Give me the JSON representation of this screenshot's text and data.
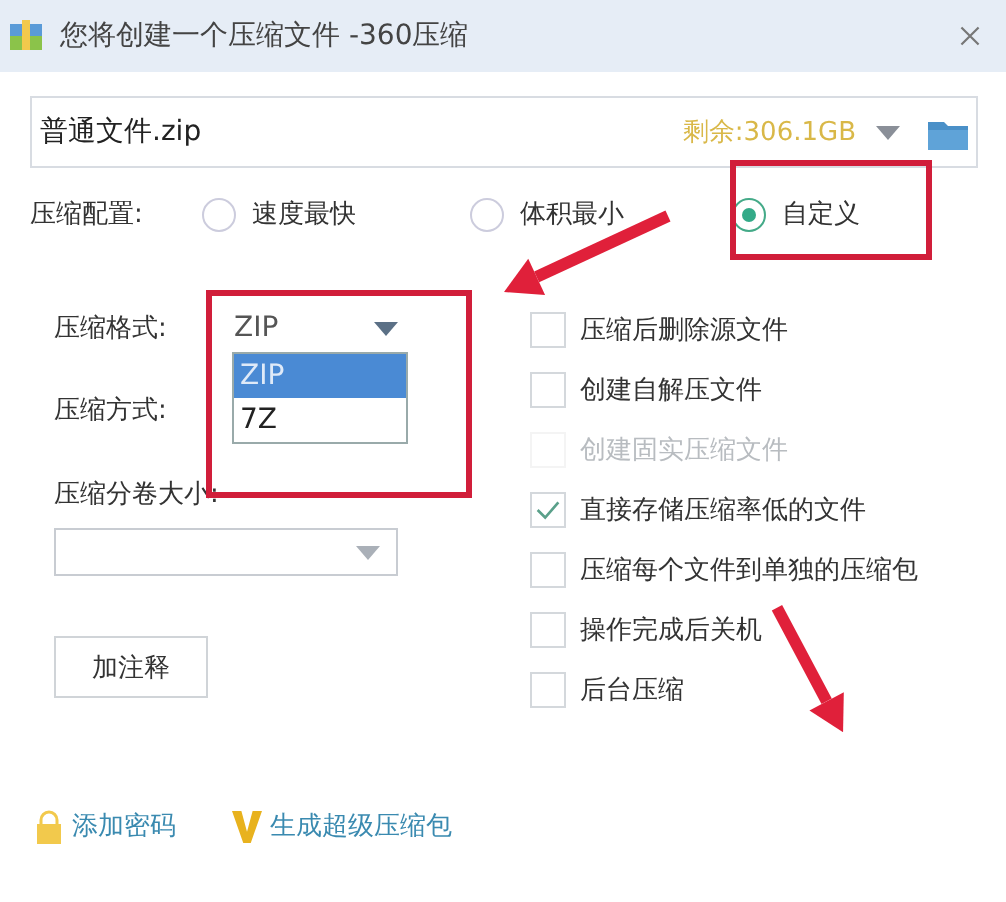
{
  "window": {
    "title": "您将创建一个压缩文件 -360压缩"
  },
  "path": {
    "value": "普通文件.zip",
    "free_space": "剩余:306.1GB"
  },
  "config": {
    "label": "压缩配置:",
    "options": [
      {
        "label": "速度最快",
        "selected": false
      },
      {
        "label": "体积最小",
        "selected": false
      },
      {
        "label": "自定义",
        "selected": true
      }
    ]
  },
  "format": {
    "label": "压缩格式:",
    "value": "ZIP",
    "expanded": true,
    "options": [
      {
        "label": "ZIP",
        "selected": true
      },
      {
        "label": "7Z",
        "selected": false
      }
    ]
  },
  "method": {
    "label": "压缩方式:"
  },
  "split": {
    "label": "压缩分卷大小:"
  },
  "comment_button": "加注释",
  "checkboxes": [
    {
      "label": "压缩后删除源文件",
      "checked": false,
      "disabled": false
    },
    {
      "label": "创建自解压文件",
      "checked": false,
      "disabled": false
    },
    {
      "label": "创建固实压缩文件",
      "checked": false,
      "disabled": true
    },
    {
      "label": "直接存储压缩率低的文件",
      "checked": true,
      "disabled": false
    },
    {
      "label": "压缩每个文件到单独的压缩包",
      "checked": false,
      "disabled": false
    },
    {
      "label": "操作完成后关机",
      "checked": false,
      "disabled": false
    },
    {
      "label": "后台压缩",
      "checked": false,
      "disabled": false
    }
  ],
  "links": [
    {
      "kind": "password",
      "label": "添加密码"
    },
    {
      "kind": "super",
      "label": "生成超级压缩包"
    }
  ]
}
